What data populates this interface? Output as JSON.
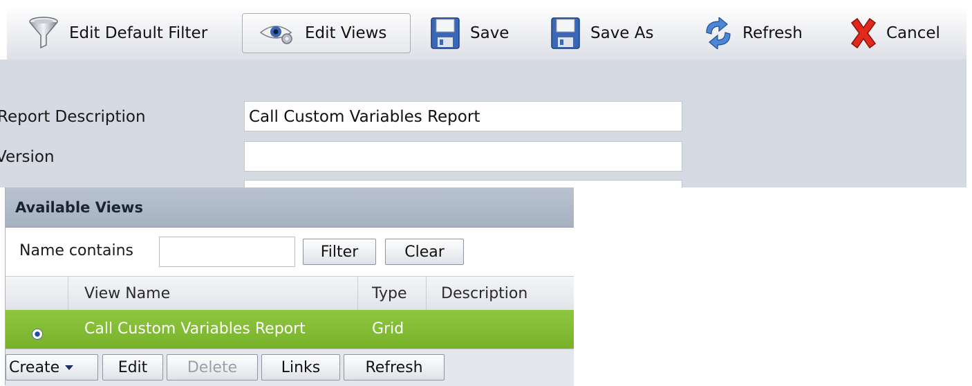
{
  "toolbar": {
    "edit_default_filter": "Edit Default Filter",
    "edit_views": "Edit Views",
    "save": "Save",
    "save_as": "Save As",
    "refresh": "Refresh",
    "cancel": "Cancel"
  },
  "icons": {
    "filter": "funnel-icon",
    "edit_views": "eye-gear-icon",
    "save": "floppy-disk-icon",
    "save_as": "floppy-disk-icon",
    "refresh": "refresh-arrows-icon",
    "cancel": "red-x-icon"
  },
  "form": {
    "report_description_label": "Report Description",
    "report_description_value": "Call Custom Variables Report",
    "version_label": "Version",
    "version_value": ""
  },
  "available_views": {
    "title": "Available Views",
    "name_contains_label": "Name contains",
    "name_contains_value": "",
    "filter_button": "Filter",
    "clear_button": "Clear",
    "columns": [
      "View Name",
      "Type",
      "Description"
    ],
    "rows": [
      {
        "name": "Call Custom Variables Report",
        "type": "Grid",
        "description": "",
        "selected": true
      }
    ],
    "actions": {
      "create": "Create",
      "edit": "Edit",
      "delete": "Delete",
      "links": "Links",
      "refresh": "Refresh"
    }
  },
  "colors": {
    "selected_row": "#80bb33",
    "panel_header": "#adb8c6",
    "form_background": "#d6dbe3"
  }
}
